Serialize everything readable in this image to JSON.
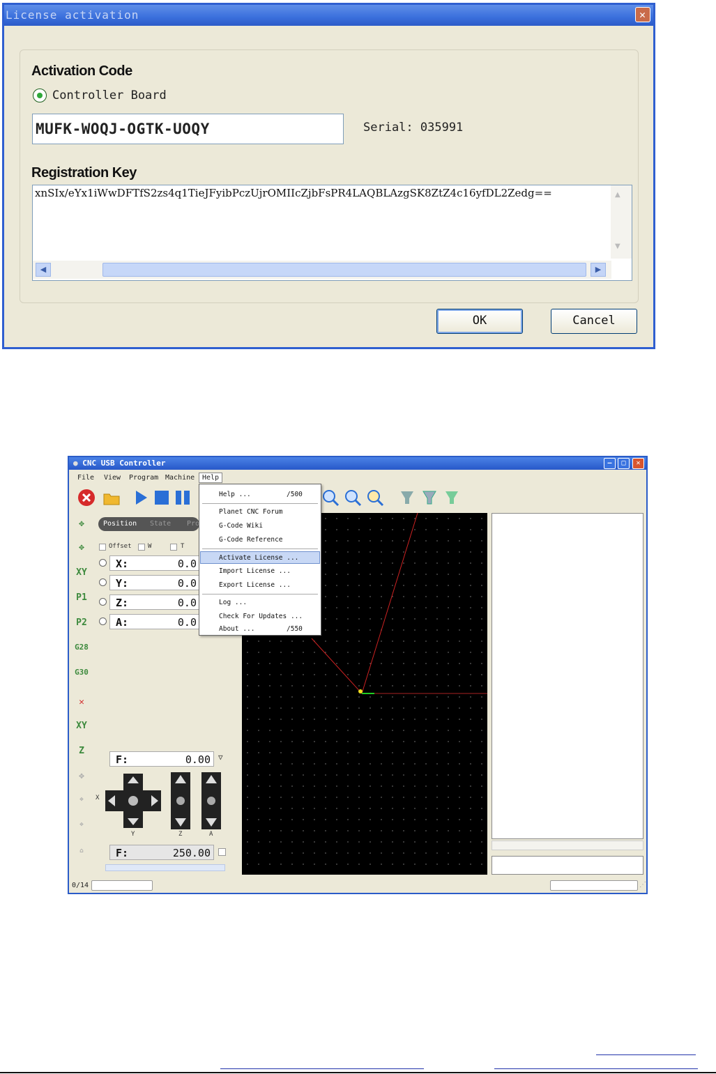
{
  "license_dialog": {
    "title": "License activation",
    "activation_code_label": "Activation Code",
    "radio_label": "Controller Board",
    "code_value": "MUFK-WOQJ-OGTK-UOQY",
    "serial_text": "Serial: 035991",
    "registration_key_label": "Registration Key",
    "registration_key_value": "xnSIx/eYx1iWwDFTfS2zs4q1TieJFyibPczUjrOMIIcZjbFsPR4LAQBLAzgSK8ZtZ4c16yfDL2Zedg==",
    "ok_label": "OK",
    "cancel_label": "Cancel"
  },
  "cnc_window": {
    "title": "CNC USB Controller",
    "menu": [
      "File",
      "View",
      "Program",
      "Machine",
      "Help"
    ],
    "tabs": [
      "Position",
      "State",
      "Pro"
    ],
    "checkboxes": [
      "Offset",
      "W",
      "T"
    ],
    "coords": [
      {
        "axis": "X:",
        "value": "0.0"
      },
      {
        "axis": "Y:",
        "value": "0.0"
      },
      {
        "axis": "Z:",
        "value": "0.0"
      },
      {
        "axis": "A:",
        "value": "0.0"
      }
    ],
    "side_buttons": [
      "XY",
      "P1",
      "P2",
      "G28",
      "G30",
      "XY",
      "Z"
    ],
    "feed_top": {
      "label": "F:",
      "value": "0.00"
    },
    "feed_bottom": {
      "label": "F:",
      "value": "250.00"
    },
    "jog_labels": {
      "x": "X",
      "y": "Y",
      "z": "Z",
      "a": "A"
    },
    "help_menu": {
      "items": [
        {
          "label": "Help ...",
          "shortcut": "/500"
        },
        {
          "label": "Planet CNC Forum",
          "shortcut": ""
        },
        {
          "label": "G-Code Wiki",
          "shortcut": ""
        },
        {
          "label": "G-Code Reference",
          "shortcut": ""
        },
        {
          "label": "Activate License ...",
          "shortcut": "",
          "highlighted": true
        },
        {
          "label": "Import License ...",
          "shortcut": ""
        },
        {
          "label": "Export License ...",
          "shortcut": ""
        },
        {
          "label": "Log ...",
          "shortcut": ""
        },
        {
          "label": "Check For Updates ...",
          "shortcut": ""
        },
        {
          "label": "About ...",
          "shortcut": "/550"
        }
      ]
    },
    "status_left": "0/14"
  },
  "colors": {
    "xp_blue": "#2b5cc8",
    "dialog_bg": "#ece9d8",
    "viewport_bg": "#000000",
    "path_red": "#cc2222",
    "menu_highlight": "#c8d8f5"
  }
}
